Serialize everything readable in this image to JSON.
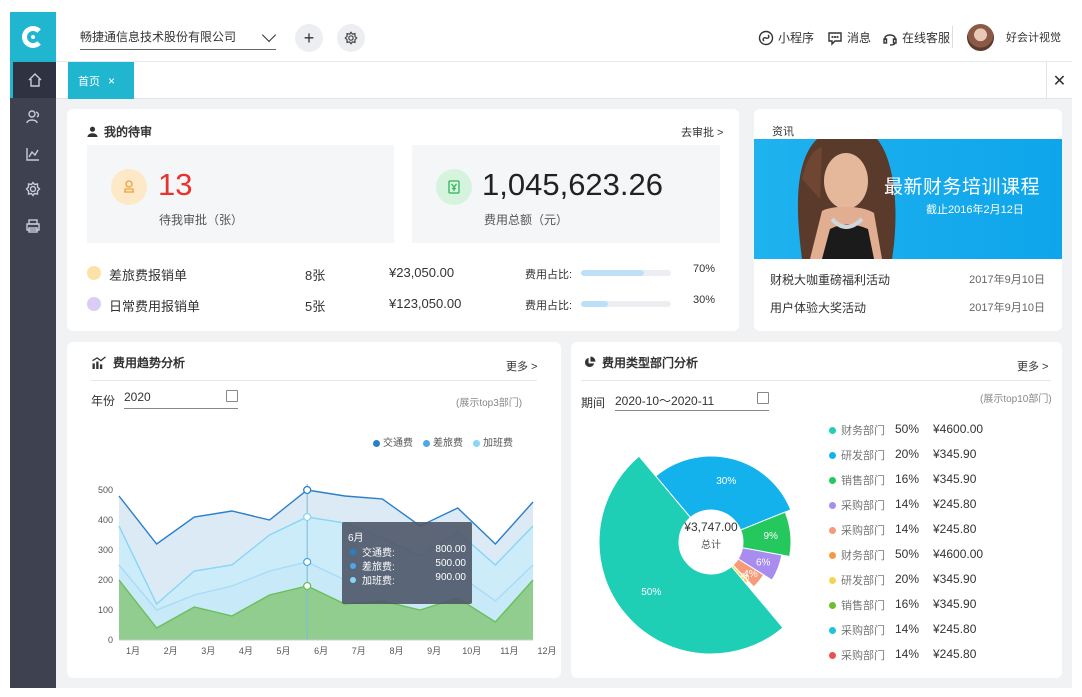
{
  "topbar": {
    "company": "畅捷通信息技术股份有限公司",
    "links": {
      "mini_program": "小程序",
      "messages": "消息",
      "support": "在线客服"
    },
    "user": "好会计视觉"
  },
  "tabs": {
    "home": "首页",
    "close": "×"
  },
  "pending": {
    "title": "我的待审",
    "go": "去审批 >",
    "count": "13",
    "count_label": "待我审批（张）",
    "amount": "1,045,623.26",
    "amount_label": "费用总额（元）",
    "rows": [
      {
        "name": "差旅费报销单",
        "count": "8张",
        "amount": "¥23,050.00",
        "ratio_label": "费用占比:",
        "ratio": "70%",
        "ratio_value": 0.7
      },
      {
        "name": "日常费用报销单",
        "count": "5张",
        "amount": "¥123,050.00",
        "ratio_label": "费用占比:",
        "ratio": "30%",
        "ratio_value": 0.3
      }
    ]
  },
  "news": {
    "title": "资讯",
    "banner_title": "最新财务培训课程",
    "banner_sub": "截止2016年2月12日",
    "items": [
      {
        "text": "财税大咖重磅福利活动",
        "date": "2017年9月10日"
      },
      {
        "text": "用户体验大奖活动",
        "date": "2017年9月10日"
      }
    ]
  },
  "trend": {
    "title": "费用趋势分析",
    "more": "更多 >",
    "year_label": "年份",
    "year": "2020",
    "hint": "(展示top3部门)",
    "tooltip": {
      "title": "6月",
      "rows": [
        {
          "name": "交通费:",
          "value": "800.00"
        },
        {
          "name": "差旅费:",
          "value": "500.00"
        },
        {
          "name": "加班费:",
          "value": "900.00"
        }
      ]
    }
  },
  "dept": {
    "title": "费用类型部门分析",
    "more": "更多 >",
    "period_label": "期间",
    "period": "2020-10～2020-11",
    "hint": "(展示top10部门)",
    "center_value": "¥3,747.00",
    "center_label": "总计",
    "rows": [
      {
        "name": "财务部门",
        "pct": "50%",
        "value": "¥4600.00",
        "color": "#1fcfb5"
      },
      {
        "name": "研发部门",
        "pct": "20%",
        "value": "¥345.90",
        "color": "#14b2ec"
      },
      {
        "name": "销售部门",
        "pct": "16%",
        "value": "¥345.90",
        "color": "#25c85c"
      },
      {
        "name": "采购部门",
        "pct": "14%",
        "value": "¥245.80",
        "color": "#a98cf0"
      },
      {
        "name": "采购部门",
        "pct": "14%",
        "value": "¥245.80",
        "color": "#f59b7a"
      },
      {
        "name": "财务部门",
        "pct": "50%",
        "value": "¥4600.00",
        "color": "#f49b41"
      },
      {
        "name": "研发部门",
        "pct": "20%",
        "value": "¥345.90",
        "color": "#f5d652"
      },
      {
        "name": "销售部门",
        "pct": "16%",
        "value": "¥345.90",
        "color": "#6dbf2d"
      },
      {
        "name": "采购部门",
        "pct": "14%",
        "value": "¥245.80",
        "color": "#20c3d8"
      },
      {
        "name": "采购部门",
        "pct": "14%",
        "value": "¥245.80",
        "color": "#ee4e4e"
      }
    ]
  },
  "chart_data": [
    {
      "type": "area",
      "x": [
        "1月",
        "2月",
        "3月",
        "4月",
        "5月",
        "6月",
        "7月",
        "8月",
        "9月",
        "10月",
        "11月",
        "12月"
      ],
      "ylim": [
        0,
        500
      ],
      "yticks": [
        0,
        100,
        200,
        300,
        400,
        500
      ],
      "legend_position": "top-right",
      "series": [
        {
          "name": "交通费",
          "color": "#2a7fc9",
          "values": [
            480,
            320,
            410,
            430,
            400,
            500,
            480,
            470,
            380,
            440,
            320,
            460
          ]
        },
        {
          "name": "差旅费",
          "color": "#4da7e8",
          "values": [
            250,
            100,
            150,
            180,
            230,
            260,
            200,
            240,
            170,
            220,
            130,
            250
          ]
        },
        {
          "name": "加班费",
          "color": "#86d6f5",
          "values": [
            380,
            120,
            230,
            250,
            350,
            410,
            390,
            340,
            280,
            360,
            250,
            380
          ]
        },
        {
          "name": "",
          "color": "#6abf59",
          "values": [
            200,
            40,
            110,
            80,
            150,
            180,
            120,
            130,
            100,
            140,
            60,
            200
          ]
        }
      ]
    },
    {
      "type": "pie",
      "labels": [
        "30%",
        "9%",
        "6%",
        "4%",
        "1%",
        "50%"
      ],
      "values": [
        30,
        9,
        6,
        4,
        1,
        50
      ],
      "colors": [
        "#14b2ec",
        "#25c85c",
        "#a98cf0",
        "#f59b7a",
        "#f5d652",
        "#1fcfb5"
      ]
    }
  ]
}
